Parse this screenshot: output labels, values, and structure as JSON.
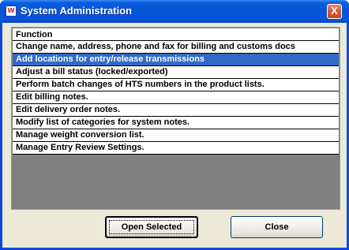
{
  "window": {
    "title": "System Administration",
    "icon": "app-icon",
    "icon_glyph": "W",
    "close_glyph": "X"
  },
  "list": {
    "header": "Function",
    "selected_index": 1,
    "items": [
      "Change name, address, phone and fax for billing and customs docs",
      "Add locations for entry/release transmissions",
      "Adjust a bill status (locked/exported)",
      "Perform batch changes of HTS numbers in the product lists.",
      "Edit billing notes.",
      "Edit delivery order notes.",
      "Modify list of categories for system notes.",
      "Manage weight conversion list.",
      "Manage Entry Review Settings."
    ]
  },
  "buttons": {
    "open_selected": "Open Selected",
    "close": "Close"
  },
  "colors": {
    "titlebar": "#0855dd",
    "selection": "#316ac5",
    "list_empty_area": "#808080",
    "dialog_face": "#ece9d8"
  }
}
